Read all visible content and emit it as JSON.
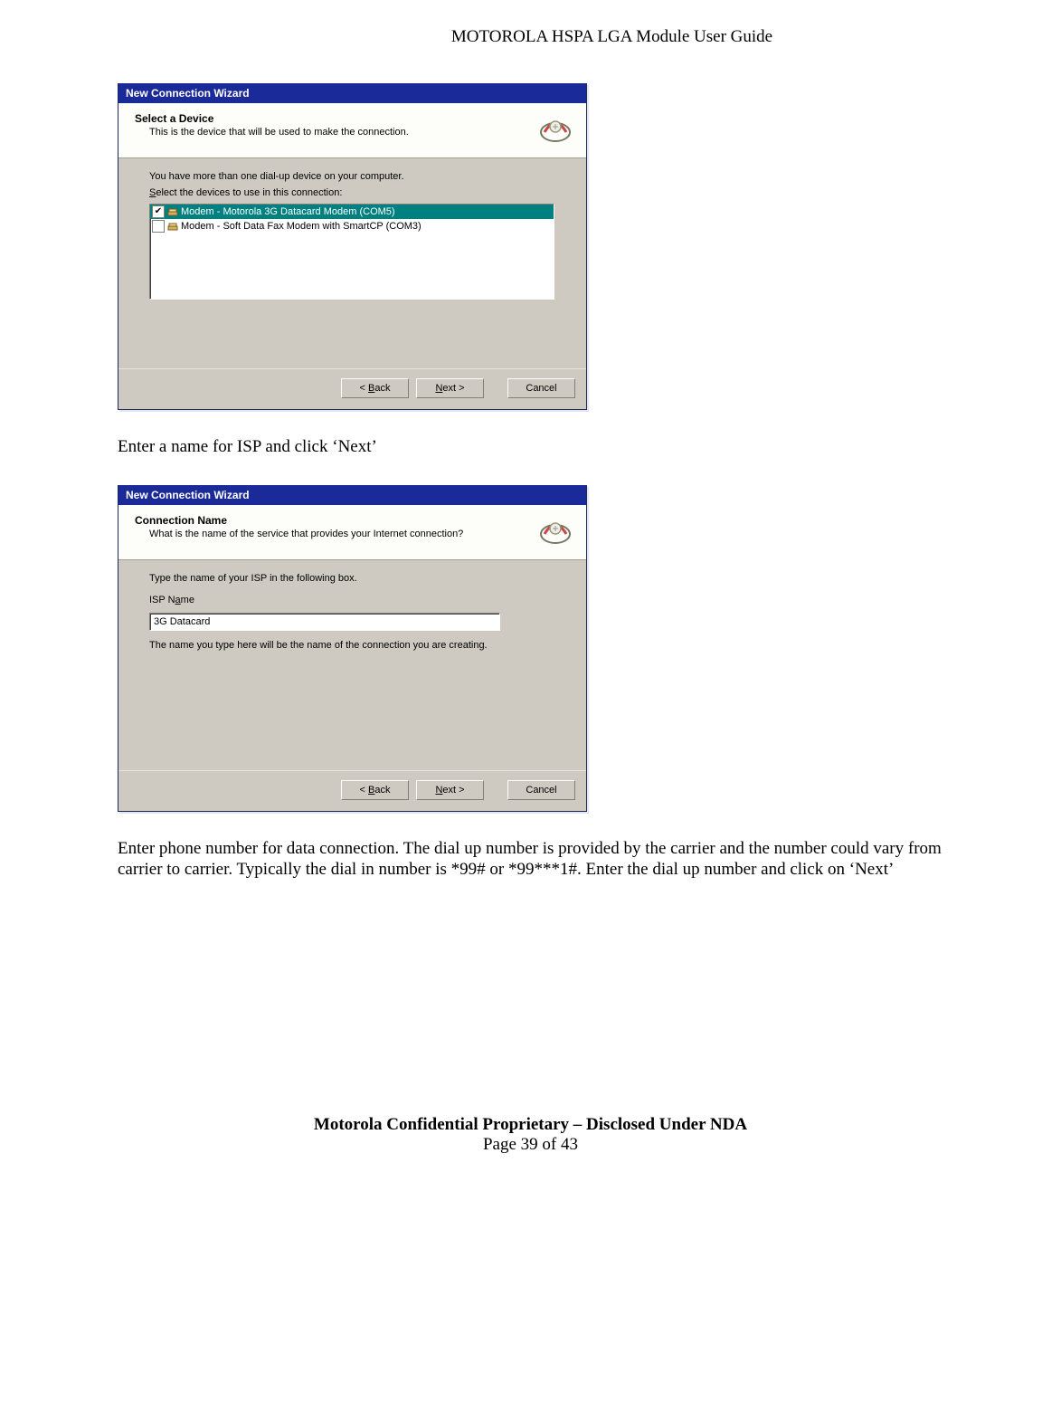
{
  "page_header": "MOTOROLA HSPA LGA Module User Guide",
  "dialog1": {
    "title": "New Connection Wizard",
    "header_title": "Select a Device",
    "header_sub": "This is the device that will be used to make the connection.",
    "instr1": "You have more than one dial-up device on your computer.",
    "instr2_pre": "S",
    "instr2_rest": "elect the devices to use in this connection:",
    "items": [
      {
        "label": "Modem - Motorola 3G Datacard Modem (COM5)",
        "checked": true,
        "selected": true
      },
      {
        "label": "Modem - Soft Data Fax Modem with SmartCP (COM3)",
        "checked": false,
        "selected": false
      }
    ],
    "back_pre": "< ",
    "back_u": "B",
    "back_rest": "ack",
    "next_u": "N",
    "next_rest": "ext >",
    "cancel": "Cancel"
  },
  "para1": "Enter a name for ISP and click ‘Next’",
  "dialog2": {
    "title": "New Connection Wizard",
    "header_title": "Connection Name",
    "header_sub": "What is the name of the service that provides your Internet connection?",
    "instr1": "Type the name of your ISP in the following box.",
    "label_pre": "ISP N",
    "label_u": "a",
    "label_rest": "me",
    "input_value": "3G Datacard",
    "note": "The name you type here will be the name of the connection you are creating.",
    "back_pre": "< ",
    "back_u": "B",
    "back_rest": "ack",
    "next_u": "N",
    "next_rest": "ext >",
    "cancel": "Cancel"
  },
  "para2": "Enter phone number for data connection.  The dial up number is provided by the carrier and the number could vary from carrier to carrier. Typically the dial in number is *99# or *99***1#.  Enter the dial up number and click on ‘Next’",
  "footer1": "Motorola Confidential Proprietary – Disclosed Under NDA",
  "footer2": "Page 39 of 43"
}
